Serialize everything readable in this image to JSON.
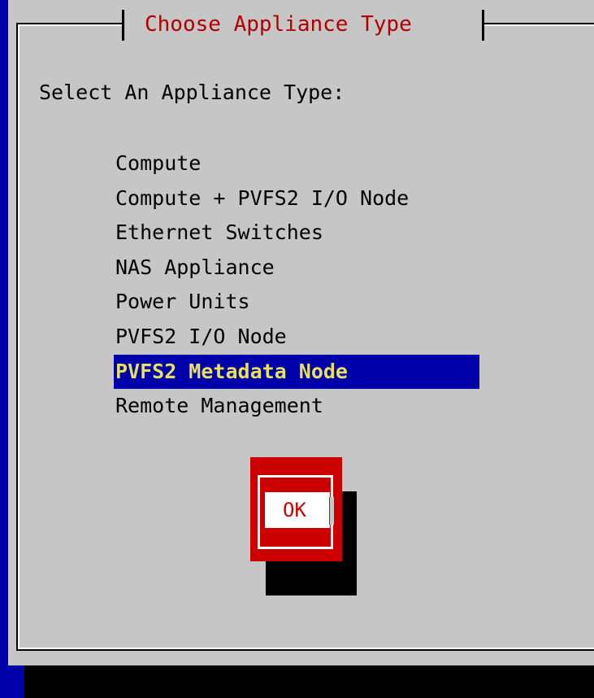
{
  "dialog": {
    "title": "Choose Appliance Type",
    "prompt": "Select An Appliance Type:",
    "options": [
      "Compute",
      "Compute + PVFS2 I/O Node",
      "Ethernet Switches",
      "NAS Appliance",
      "Power Units",
      "PVFS2 I/O Node",
      "PVFS2 Metadata Node",
      "Remote Management"
    ],
    "selected_option": "PVFS2 Metadata Node",
    "ok_label": "OK"
  },
  "colors": {
    "screen_background": "#0000aa",
    "dialog_background": "#c6c6c6",
    "title_text": "#b00000",
    "selection_background": "#0000aa",
    "selection_text": "#e8e05a",
    "button_red": "#cc0000"
  }
}
